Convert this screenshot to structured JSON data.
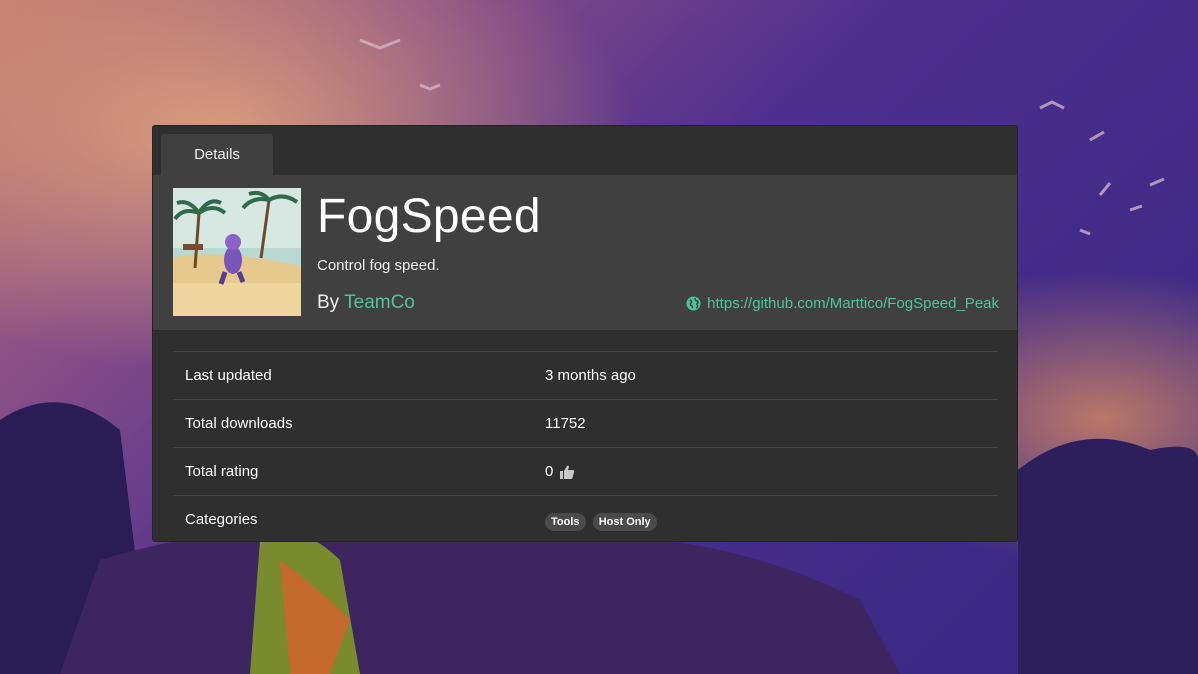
{
  "tabs": [
    {
      "label": "Details"
    }
  ],
  "mod": {
    "name": "FogSpeed",
    "description": "Control fog speed.",
    "by_prefix": "By",
    "author": "TeamCo",
    "website": "https://github.com/Marttico/FogSpeed_Peak"
  },
  "stats": {
    "last_updated_label": "Last updated",
    "last_updated_value": "3 months ago",
    "downloads_label": "Total downloads",
    "downloads_value": "11752",
    "rating_label": "Total rating",
    "rating_value": "0",
    "categories_label": "Categories",
    "categories": [
      "Tools",
      "Host Only"
    ]
  },
  "colors": {
    "accent": "#4fc2a0",
    "panel": "#2f2f2f",
    "header": "#404040"
  },
  "icons": {
    "website": "globe-icon",
    "rating": "thumbs-up-icon"
  }
}
